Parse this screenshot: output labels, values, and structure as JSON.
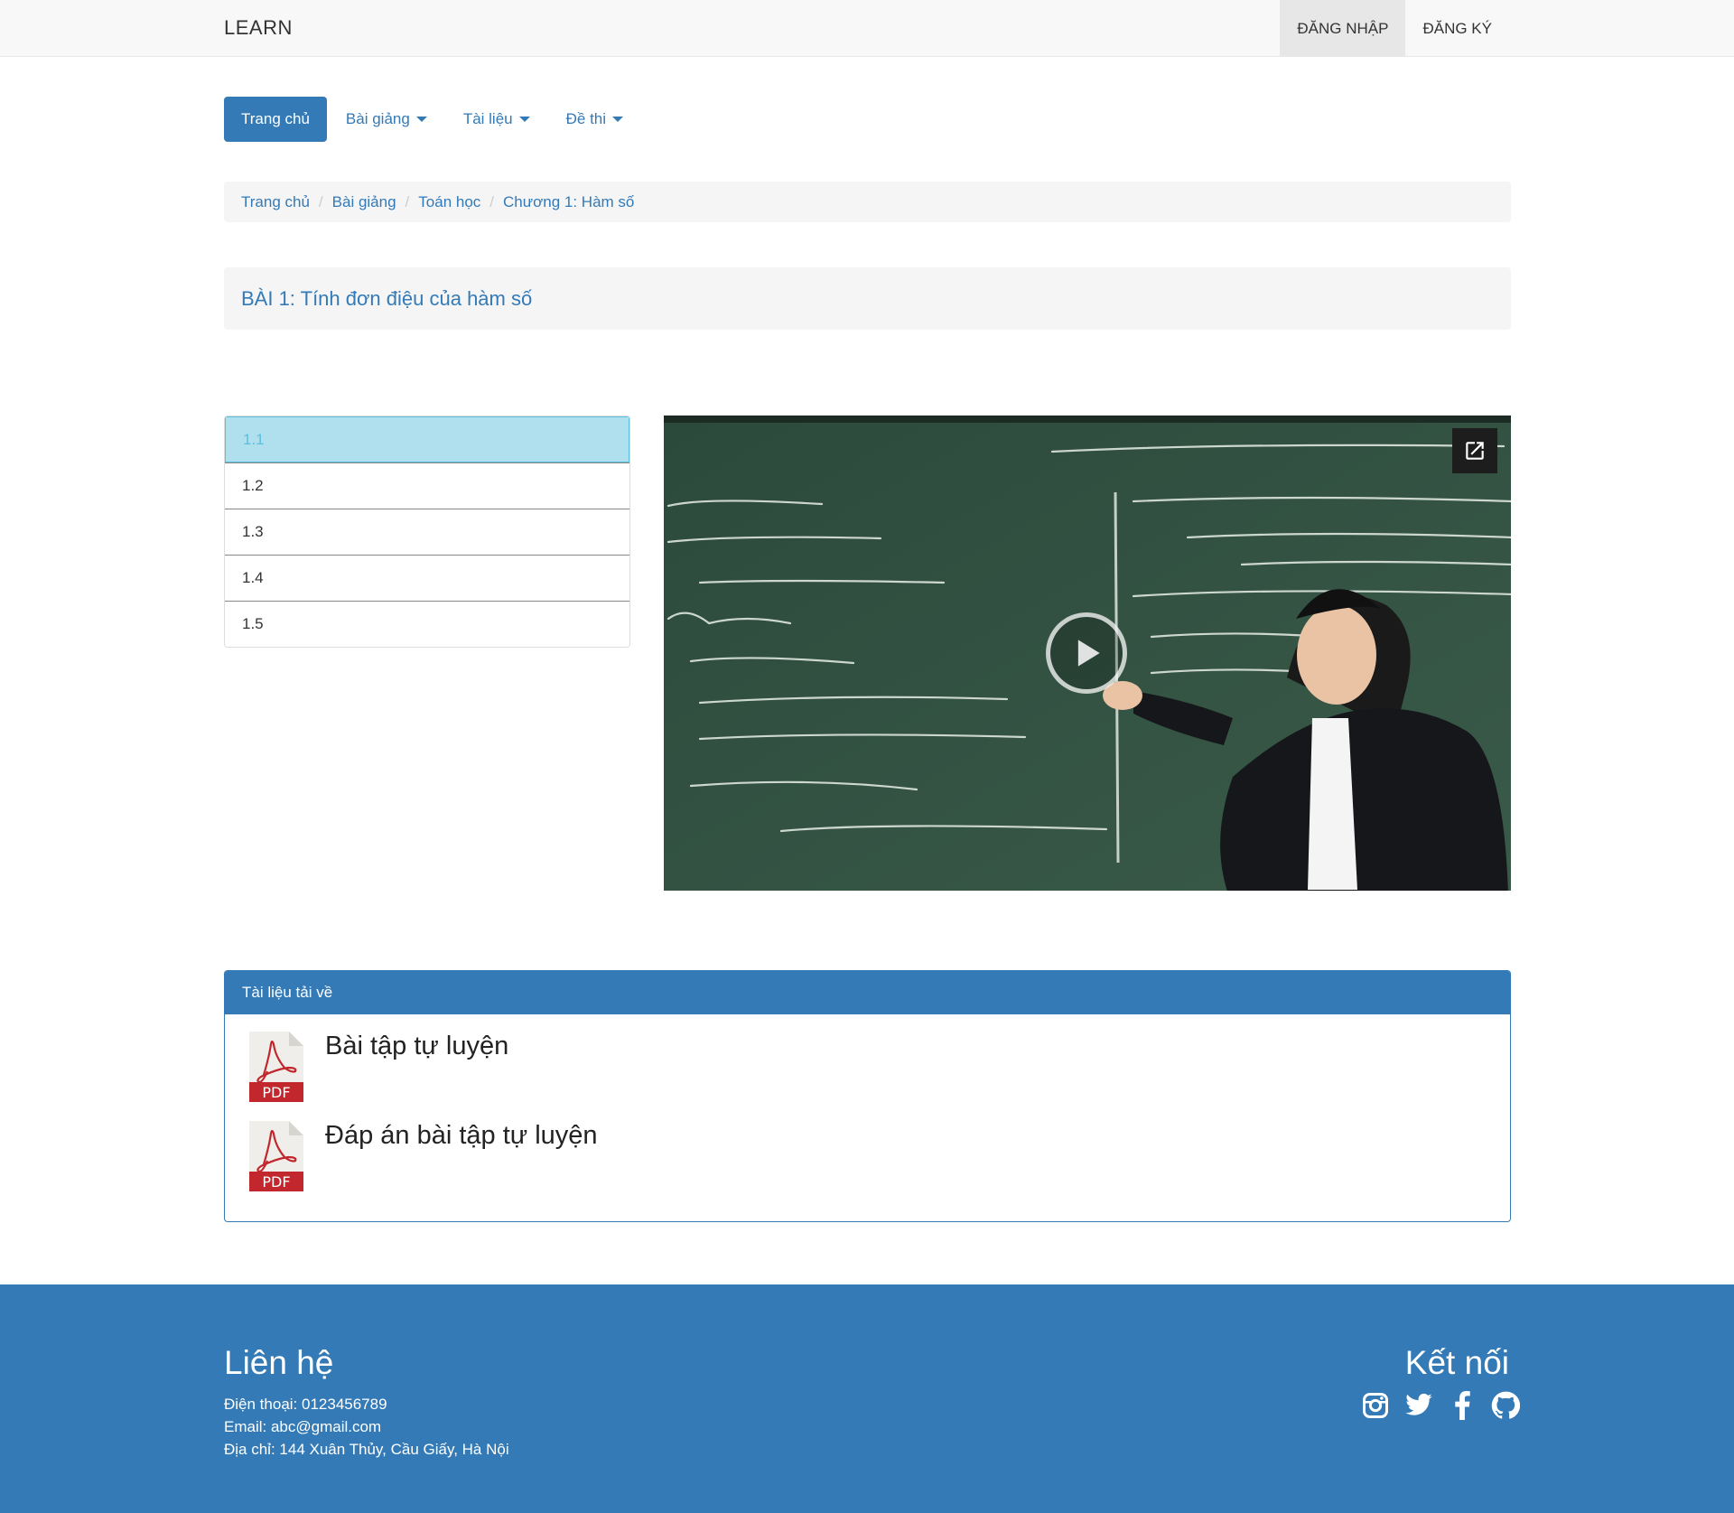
{
  "navbar": {
    "brand": "LEARN",
    "login": "ĐĂNG NHẬP",
    "register": "ĐĂNG KÝ"
  },
  "nav": {
    "home": "Trang chủ",
    "lectures": "Bài giảng",
    "documents": "Tài liệu",
    "exams": "Đề thi"
  },
  "breadcrumb": [
    "Trang chủ",
    "Bài giảng",
    "Toán học",
    "Chương 1: Hàm số"
  ],
  "lesson": {
    "title": "BÀI 1: Tính đơn điệu của hàm số"
  },
  "parts": [
    {
      "label": "1.1",
      "active": true
    },
    {
      "label": "1.2",
      "active": false
    },
    {
      "label": "1.3",
      "active": false
    },
    {
      "label": "1.4",
      "active": false
    },
    {
      "label": "1.5",
      "active": false
    }
  ],
  "downloads": {
    "heading": "Tài liệu tải về",
    "items": [
      "Bài tập tự luyện",
      "Đáp án bài tập tự luyện"
    ],
    "file_badge": "PDF"
  },
  "footer": {
    "contact_title": "Liên hệ",
    "phone": "Điện thoại: 0123456789",
    "email": "Email: abc@gmail.com",
    "address": "Địa chỉ: 144 Xuân Thủy, Cầu Giấy, Hà Nội",
    "connect_title": "Kết nối",
    "social_icons": [
      "instagram-icon",
      "twitter-icon",
      "facebook-icon",
      "github-icon"
    ]
  },
  "colors": {
    "primary": "#337ab7",
    "active_item_bg": "#b0e0ee",
    "active_item_text": "#5bc0de",
    "board_green": "#2f4a3d"
  }
}
